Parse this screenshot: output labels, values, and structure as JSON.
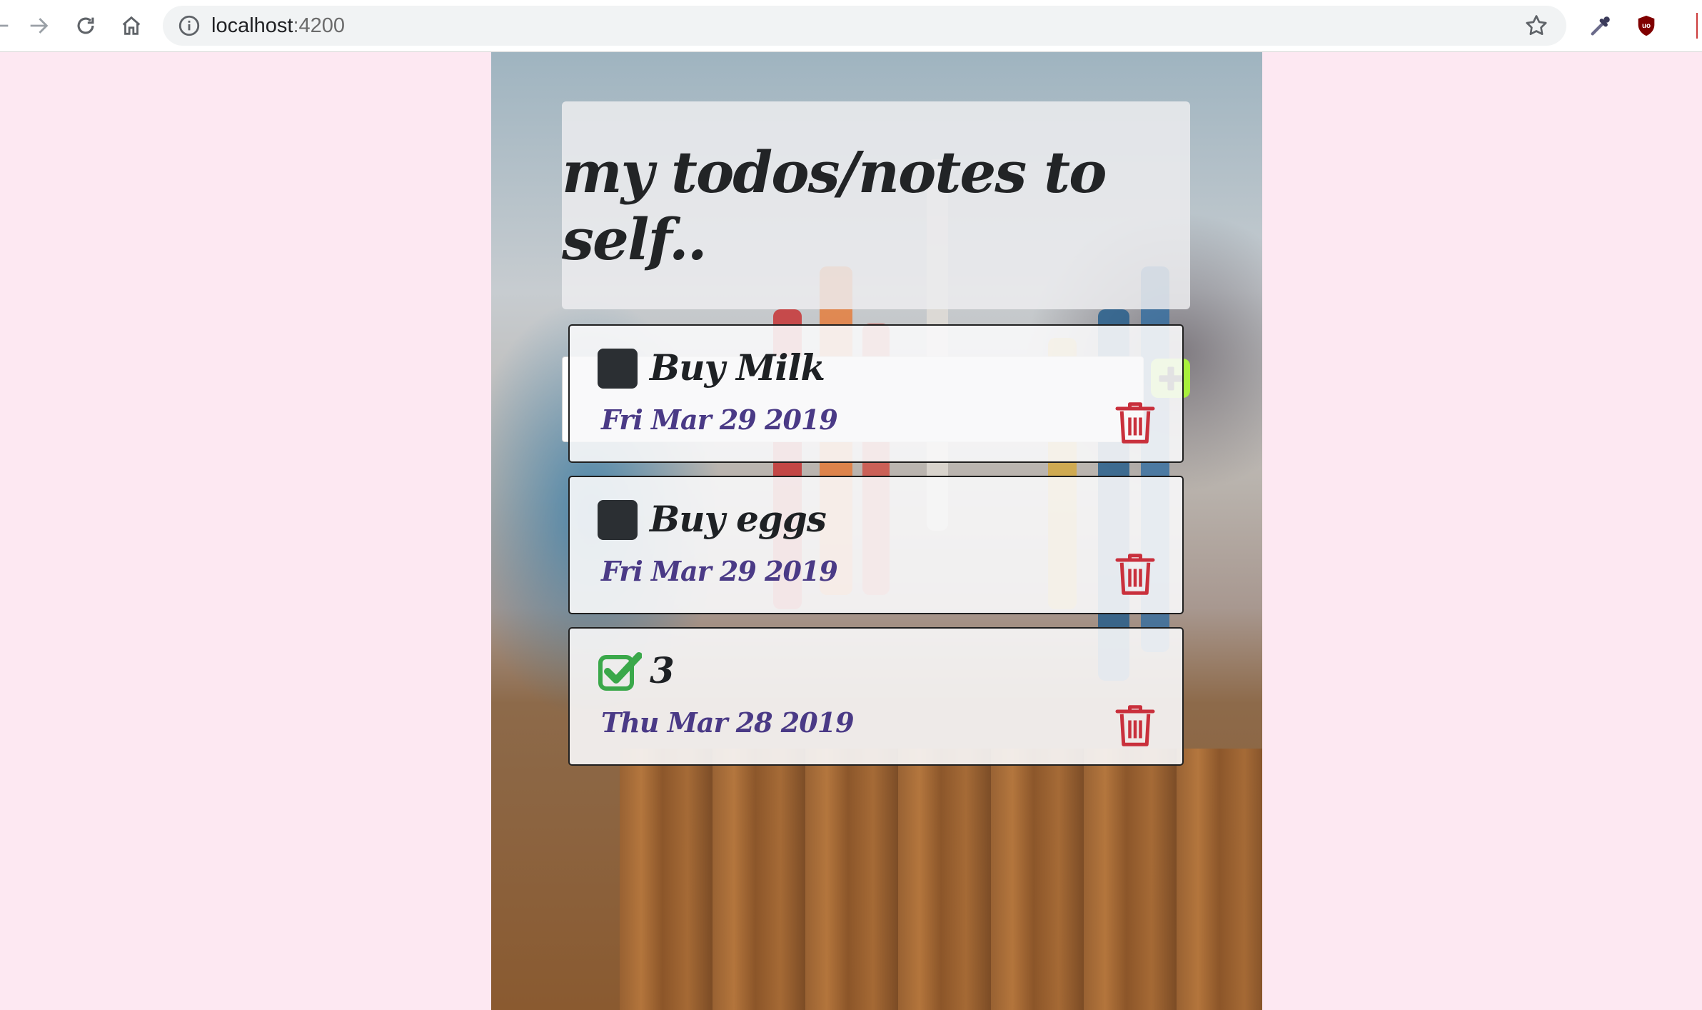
{
  "browser": {
    "url_host": "localhost",
    "url_port": ":4200",
    "icons": [
      "back-arrow-icon",
      "forward-arrow-icon",
      "reload-icon",
      "home-icon",
      "info-icon",
      "star-icon",
      "eyedropper-icon",
      "ublock-icon"
    ]
  },
  "app": {
    "title": "my todos/notes to self..",
    "new_todo": {
      "value": "",
      "placeholder": ""
    },
    "add_icon": "plus-icon",
    "todos": [
      {
        "title": "Buy Milk",
        "date": "Fri Mar 29 2019",
        "done": false
      },
      {
        "title": "Buy eggs",
        "date": "Fri Mar 29 2019",
        "done": false
      },
      {
        "title": "3",
        "date": "Thu Mar 28 2019",
        "done": true
      }
    ]
  },
  "colors": {
    "page_background": "#fde8f2",
    "add_button": "#a8f03c",
    "delete_icon": "#c9303c",
    "check_green": "#3aa84a",
    "date_text": "#4a3a86"
  }
}
